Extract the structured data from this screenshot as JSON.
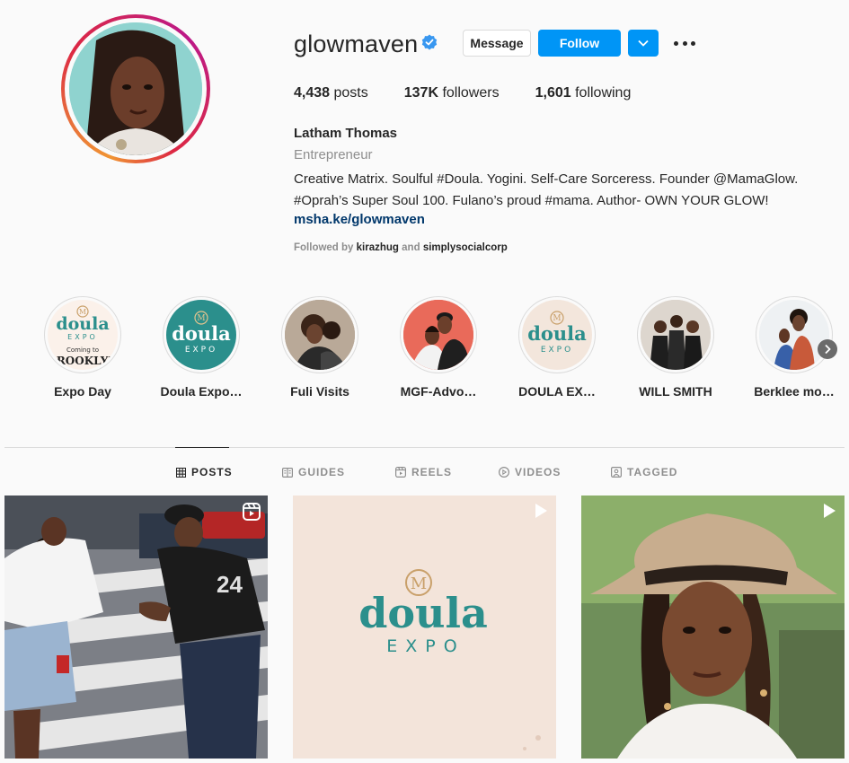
{
  "profile": {
    "username": "glowmaven",
    "verified": true,
    "buttons": {
      "message": "Message",
      "follow": "Follow"
    },
    "stats": {
      "posts": "4,438",
      "posts_label": "posts",
      "followers": "137K",
      "followers_label": "followers",
      "following": "1,601",
      "following_label": "following"
    },
    "full_name": "Latham Thomas",
    "category": "Entrepreneur",
    "bio_line1": "Creative Matrix. Soulful #Doula. Yogini. Self-Care Sorceress. Founder @MamaGlow.",
    "bio_line2": "#Oprah’s Super Soul 100. Fulano’s proud #mama. Author- OWN YOUR GLOW!",
    "link": "msha.ke/glowmaven",
    "followed_by_prefix": "Followed by",
    "followed_by_1": "kirazhug",
    "followed_by_and": "and",
    "followed_by_2": "simplysocialcorp"
  },
  "highlights": [
    {
      "label": "Expo Day",
      "img_text1": "doula",
      "img_text2": "EXPO",
      "img_text3": "Coming to",
      "img_text4": "BROOKLYN"
    },
    {
      "label": "Doula Expo…",
      "img_text1": "doula",
      "img_text2": "EXPO"
    },
    {
      "label": "Fuli Visits"
    },
    {
      "label": "MGF-Advo…"
    },
    {
      "label": "DOULA EX…",
      "img_text1": "doula",
      "img_text2": "EXPO"
    },
    {
      "label": "WILL SMITH"
    },
    {
      "label": "Berklee mo…"
    }
  ],
  "tabs": [
    {
      "label": "POSTS",
      "icon": "grid-icon",
      "active": true
    },
    {
      "label": "GUIDES",
      "icon": "guides-icon"
    },
    {
      "label": "REELS",
      "icon": "reels-icon"
    },
    {
      "label": "VIDEOS",
      "icon": "video-icon"
    },
    {
      "label": "TAGGED",
      "icon": "tagged-icon"
    }
  ],
  "posts": [
    {
      "type": "reel",
      "jersey": "24"
    },
    {
      "type": "video",
      "logo_text1": "doula",
      "logo_text2": "EXPO"
    },
    {
      "type": "video"
    }
  ],
  "colors": {
    "accent": "#0095f6",
    "link": "#00376b",
    "muted": "#8e8e8e",
    "doula_teal": "#2b8f8c"
  }
}
